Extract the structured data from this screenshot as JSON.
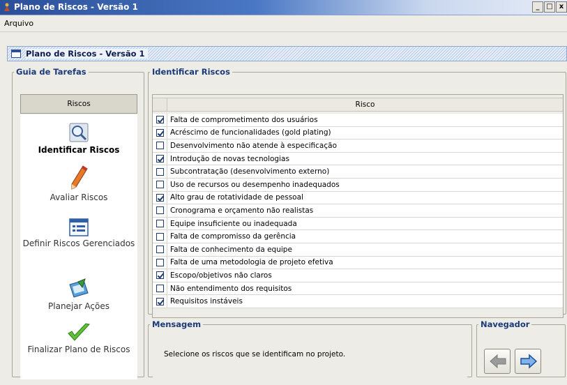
{
  "window": {
    "title": "Plano de Riscos - Versão 1",
    "buttons": [
      "_",
      "□",
      "x"
    ]
  },
  "menu": {
    "items": [
      "Arquivo"
    ]
  },
  "internal_frame": {
    "title": "Plano de Riscos - Versão 1"
  },
  "guia": {
    "legend": "Guia de Tarefas",
    "tab": "Riscos",
    "steps": [
      {
        "label": "Identificar Riscos",
        "icon": "magnifier-icon",
        "active": true
      },
      {
        "label": "Avaliar Riscos",
        "icon": "pencil-icon",
        "active": false
      },
      {
        "label": "Definir Riscos Gerenciados",
        "icon": "list-icon",
        "active": false
      },
      {
        "label": "Planejar Ações",
        "icon": "planning-icon",
        "active": false
      },
      {
        "label": "Finalizar Plano de Riscos",
        "icon": "checkmark-icon",
        "active": false
      }
    ]
  },
  "identificar": {
    "legend": "Identificar Riscos",
    "column_header": "Risco",
    "rows": [
      {
        "text": "Falta de comprometimento dos usuários",
        "checked": true
      },
      {
        "text": "Acréscimo de funcionalidades (gold plating)",
        "checked": true
      },
      {
        "text": "Desenvolvimento não atende à especificação",
        "checked": false
      },
      {
        "text": "Introdução de novas tecnologias",
        "checked": true
      },
      {
        "text": "Subcontratação (desenvolvimento externo)",
        "checked": false
      },
      {
        "text": "Uso de recursos ou desempenho inadequados",
        "checked": false
      },
      {
        "text": "Alto grau de rotatividade de pessoal",
        "checked": true
      },
      {
        "text": "Cronograma e orçamento não realistas",
        "checked": false
      },
      {
        "text": "Equipe insuficiente ou inadequada",
        "checked": false
      },
      {
        "text": "Falta de compromisso da gerência",
        "checked": false
      },
      {
        "text": "Falta de conhecimento da equipe",
        "checked": false
      },
      {
        "text": "Falta de uma metodologia de projeto efetiva",
        "checked": false
      },
      {
        "text": "Escopo/objetivos não claros",
        "checked": true
      },
      {
        "text": "Não entendimento dos requisitos",
        "checked": false
      },
      {
        "text": "Requisitos instáveis",
        "checked": true
      }
    ]
  },
  "mensagem": {
    "legend": "Mensagem",
    "text": "Selecione os riscos que se identificam no projeto."
  },
  "navegador": {
    "legend": "Navegador",
    "back_icon": "arrow-left-icon",
    "forward_icon": "arrow-right-icon"
  },
  "colors": {
    "title_blue": "#2b4f98",
    "legend_blue": "#1a3a7a",
    "check_blue": "#1f3a6e"
  }
}
